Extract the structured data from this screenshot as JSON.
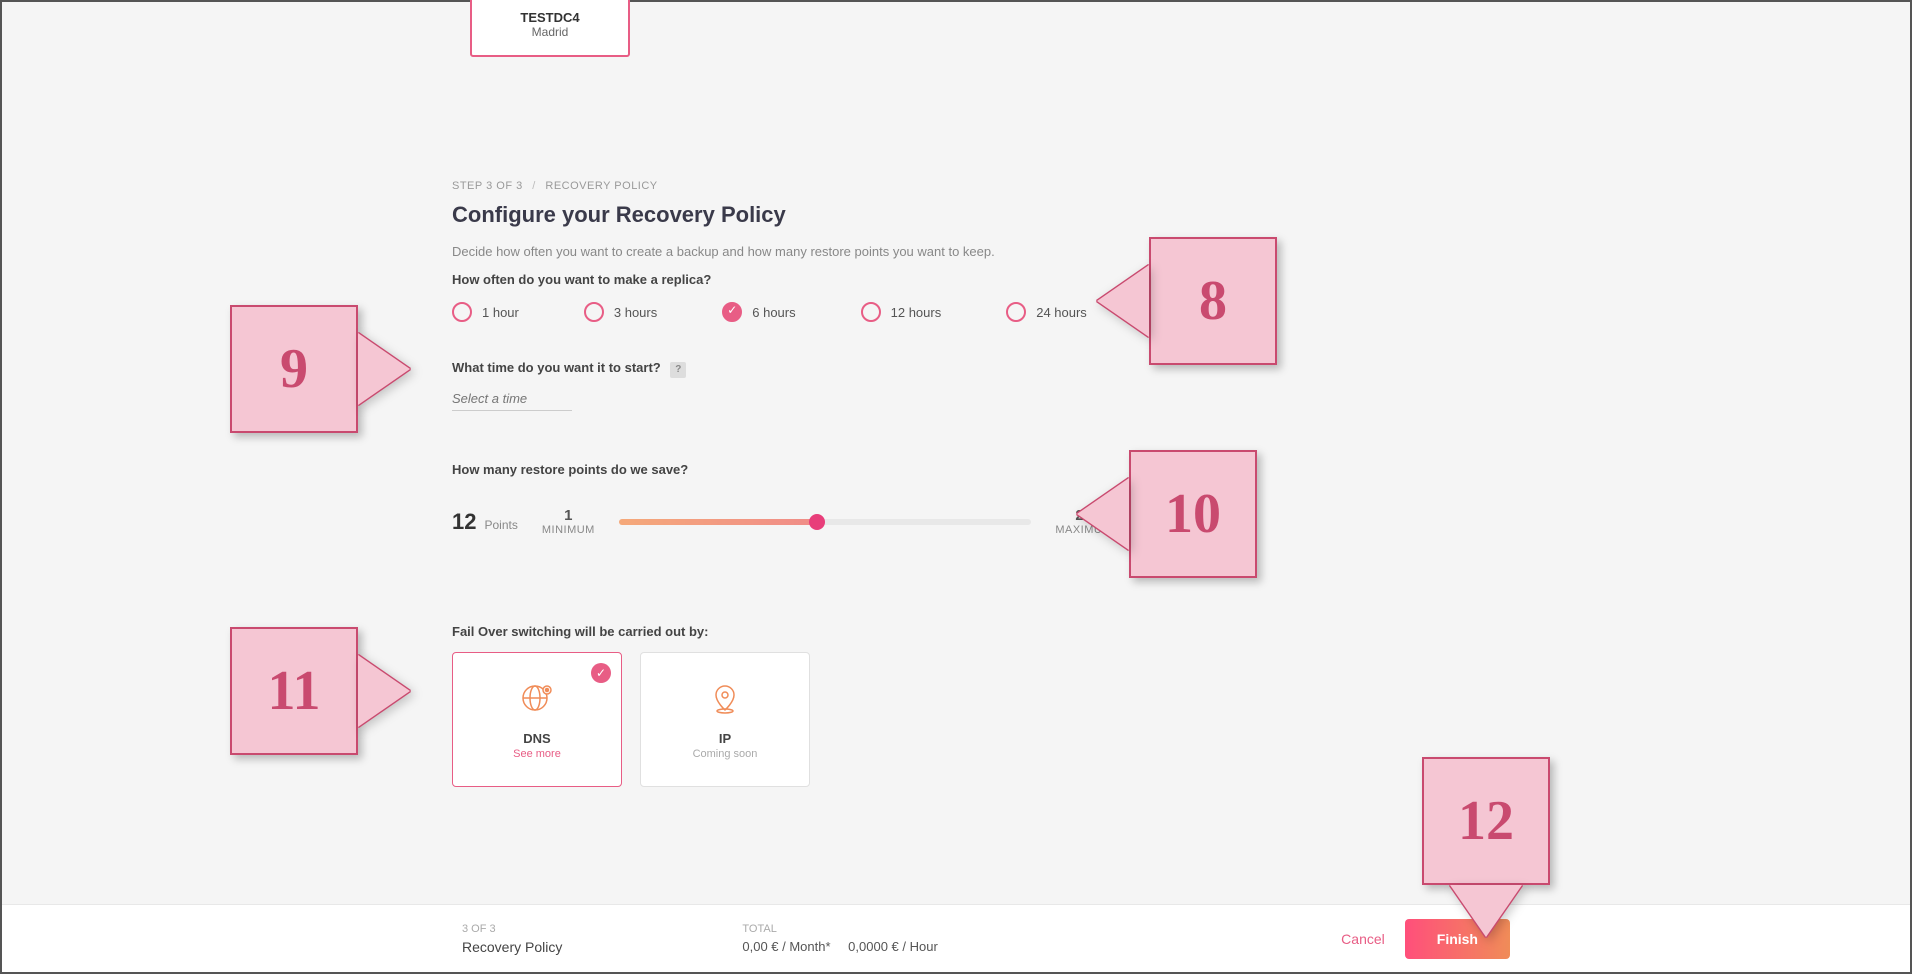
{
  "datacard": {
    "name": "TESTDC4",
    "location": "Madrid"
  },
  "breadcrumb": {
    "step": "STEP 3 OF 3",
    "section": "RECOVERY POLICY"
  },
  "title": "Configure your Recovery Policy",
  "description": "Decide how often you want to create a backup and how many restore points you want to keep.",
  "replica": {
    "question": "How often do you want to make a replica?",
    "options": [
      "1 hour",
      "3 hours",
      "6 hours",
      "12 hours",
      "24 hours"
    ],
    "selected": "6 hours"
  },
  "startTime": {
    "question": "What time do you want it to start?",
    "placeholder": "Select a time",
    "help": "?"
  },
  "restore": {
    "question": "How many restore points do we save?",
    "value": "12",
    "unit": "Points",
    "min": "1",
    "minLabel": "MINIMUM",
    "max": "24",
    "maxLabel": "MAXIMUM"
  },
  "failover": {
    "question": "Fail Over switching will be carried out by:",
    "options": [
      {
        "title": "DNS",
        "sub": "See more",
        "selected": true
      },
      {
        "title": "IP",
        "sub": "Coming soon",
        "selected": false
      }
    ]
  },
  "footer": {
    "stepCount": "3 OF 3",
    "stepName": "Recovery Policy",
    "totalLabel": "TOTAL",
    "priceMonth": "0,00 € / Month*",
    "priceHour": "0,0000 € / Hour",
    "cancel": "Cancel",
    "finish": "Finish"
  },
  "callouts": {
    "c8": "8",
    "c9": "9",
    "c10": "10",
    "c11": "11",
    "c12": "12"
  }
}
